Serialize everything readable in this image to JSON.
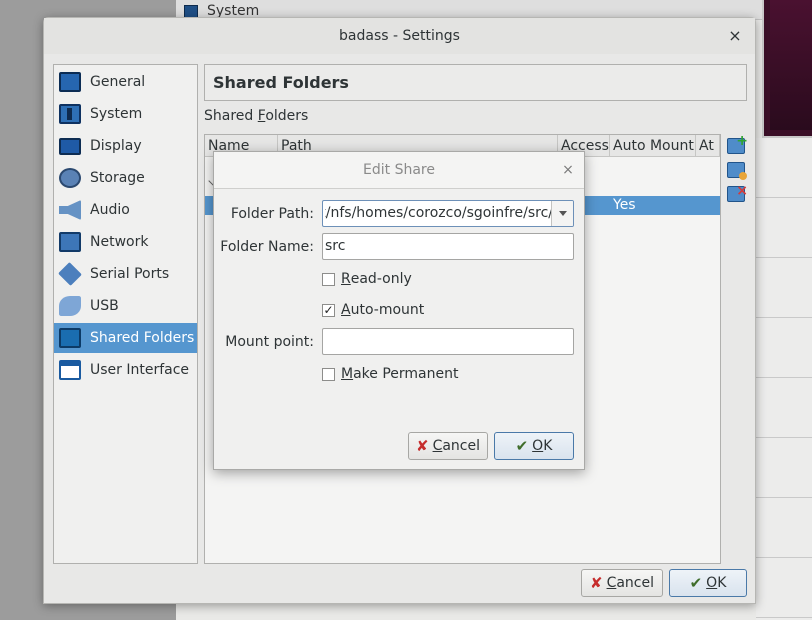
{
  "background": {
    "behind_item_label": "System"
  },
  "settings": {
    "title": "badass - Settings",
    "close_glyph": "×",
    "sidebar": {
      "items": [
        {
          "label": "General",
          "icon": "general-icon"
        },
        {
          "label": "System",
          "icon": "system-icon"
        },
        {
          "label": "Display",
          "icon": "display-icon"
        },
        {
          "label": "Storage",
          "icon": "storage-icon"
        },
        {
          "label": "Audio",
          "icon": "audio-icon"
        },
        {
          "label": "Network",
          "icon": "network-icon"
        },
        {
          "label": "Serial Ports",
          "icon": "serial-ports-icon"
        },
        {
          "label": "USB",
          "icon": "usb-icon"
        },
        {
          "label": "Shared Folders",
          "icon": "shared-folders-icon",
          "selected": true
        },
        {
          "label": "User Interface",
          "icon": "user-interface-icon"
        }
      ]
    },
    "page_title": "Shared Folders",
    "group_label": {
      "pre": "Shared ",
      "mnemonic": "F",
      "post": "olders"
    },
    "table": {
      "columns": [
        "Name",
        "Path",
        "Access",
        "Auto Mount",
        "At"
      ],
      "selected_row": {
        "auto_mount": "Yes"
      }
    },
    "buttons": {
      "cancel": {
        "mnemonic": "C",
        "rest": "ancel"
      },
      "ok": {
        "mnemonic": "O",
        "rest": "K"
      }
    },
    "colors": {
      "selection": "#5596cf"
    }
  },
  "edit_share": {
    "title": "Edit Share",
    "close_glyph": "×",
    "folder_path": {
      "label": "Folder Path:",
      "value": "/mnt/nfs/homes/corozco/sgoinfre/src"
    },
    "folder_name": {
      "label": "Folder Name:",
      "value": "src"
    },
    "read_only": {
      "mnemonic": "R",
      "rest": "ead-only",
      "checked": false
    },
    "auto_mount": {
      "mnemonic": "A",
      "rest": "uto-mount",
      "checked": true,
      "check_glyph": "✓"
    },
    "mount_point": {
      "label": "Mount point:",
      "value": ""
    },
    "make_permanent": {
      "mnemonic": "M",
      "rest": "ake Permanent",
      "checked": false
    },
    "buttons": {
      "cancel": {
        "mnemonic": "C",
        "rest": "ancel"
      },
      "ok": {
        "mnemonic": "O",
        "rest": "K"
      }
    }
  }
}
